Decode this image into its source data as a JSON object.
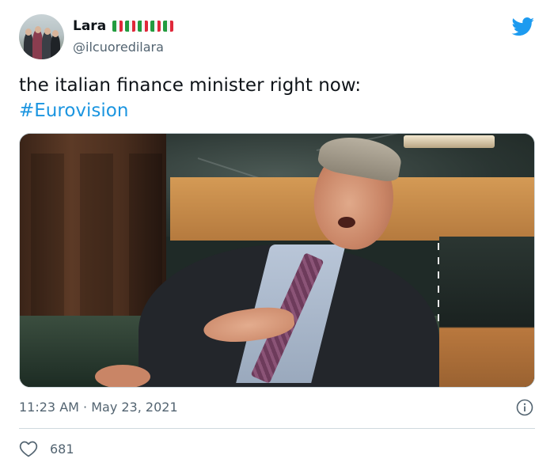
{
  "user": {
    "display_name": "Lara",
    "handle": "@ilcuoredilara",
    "name_flags": [
      "italy-flag-icon",
      "italy-flag-icon",
      "italy-flag-icon",
      "italy-flag-icon",
      "italy-flag-icon"
    ]
  },
  "tweet": {
    "text": "the italian finance minister right now:",
    "hashtag": "#Eurovision"
  },
  "media": {
    "type": "photo"
  },
  "meta": {
    "timestamp": "11:23 AM · May 23, 2021",
    "likes": "681"
  },
  "icons": {
    "brand": "twitter-bird-icon",
    "info": "info-icon",
    "like": "heart-icon"
  },
  "colors": {
    "hashtag": "#1b95e0",
    "twitter_blue": "#1d9bf0",
    "secondary_text": "#536471"
  }
}
